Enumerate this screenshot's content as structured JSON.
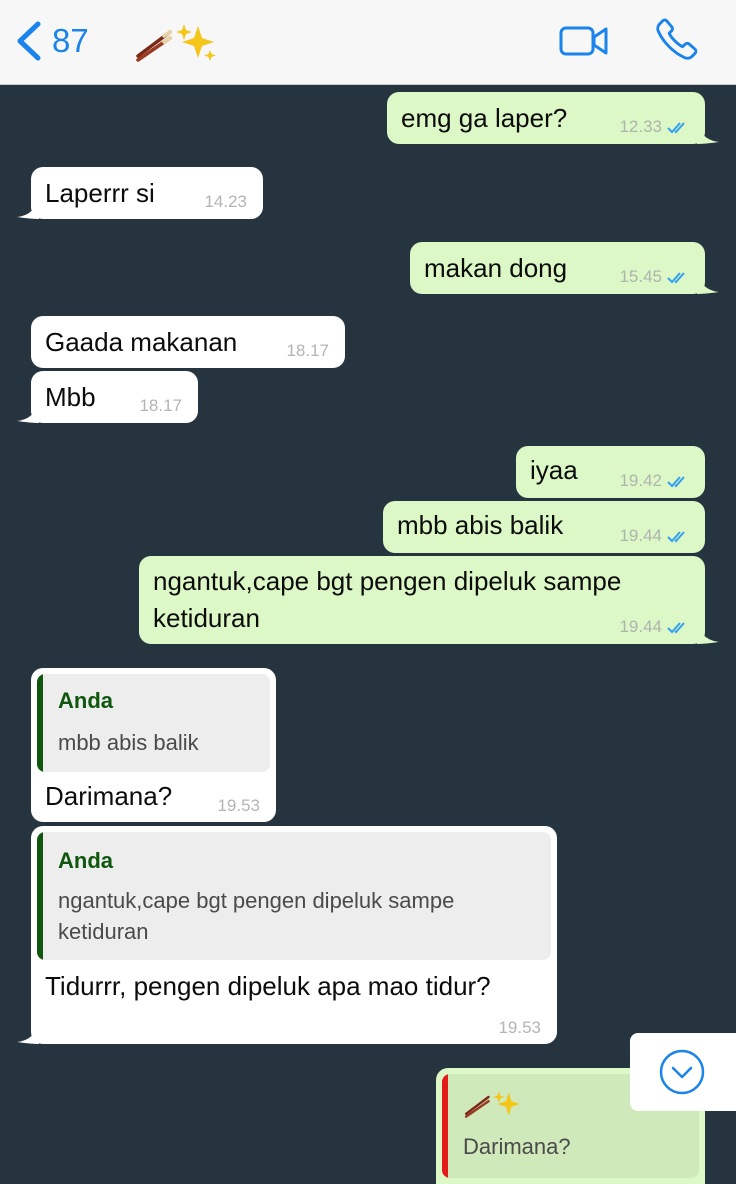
{
  "header": {
    "back_count": "87",
    "contact_emoji": "🥢✨",
    "video_icon": "video-camera-icon",
    "call_icon": "phone-icon"
  },
  "colors": {
    "accent": "#1a84ec",
    "outgoing": "#dcf8c6",
    "incoming": "#ffffff",
    "background": "#25343f",
    "quote_author": "#0f570e",
    "quote_bar_self": "#e31b1b"
  },
  "messages": [
    {
      "dir": "out",
      "text": "emg ga laper?",
      "time": "12.33",
      "read": true
    },
    {
      "dir": "in",
      "text": "Laperrr si",
      "time": "14.23"
    },
    {
      "dir": "out",
      "text": "makan dong",
      "time": "15.45",
      "read": true
    },
    {
      "dir": "in",
      "text": "Gaada makanan",
      "time": "18.17"
    },
    {
      "dir": "in",
      "text": "Mbb",
      "time": "18.17"
    },
    {
      "dir": "out",
      "text": "iyaa",
      "time": "19.42",
      "read": true
    },
    {
      "dir": "out",
      "text": "mbb abis balik",
      "time": "19.44",
      "read": true
    },
    {
      "dir": "out",
      "text_line1": "ngantuk,cape bgt pengen dipeluk sampe",
      "text_line2": "ketiduran",
      "time": "19.44",
      "read": true
    },
    {
      "dir": "in",
      "quote_author": "Anda",
      "quote_text": "mbb abis balik",
      "text": "Darimana?",
      "time": "19.53"
    },
    {
      "dir": "in",
      "quote_author": "Anda",
      "quote_line1": "ngantuk,cape bgt pengen dipeluk sampe",
      "quote_line2": "ketiduran",
      "text": "Tidurrr, pengen dipeluk apa mao tidur?",
      "time": "19.53"
    },
    {
      "dir": "out",
      "quote_author_emoji": "🥢✨",
      "quote_text": "Darimana?"
    }
  ],
  "scroll_button": {
    "icon": "chevron-down-circle-icon"
  }
}
